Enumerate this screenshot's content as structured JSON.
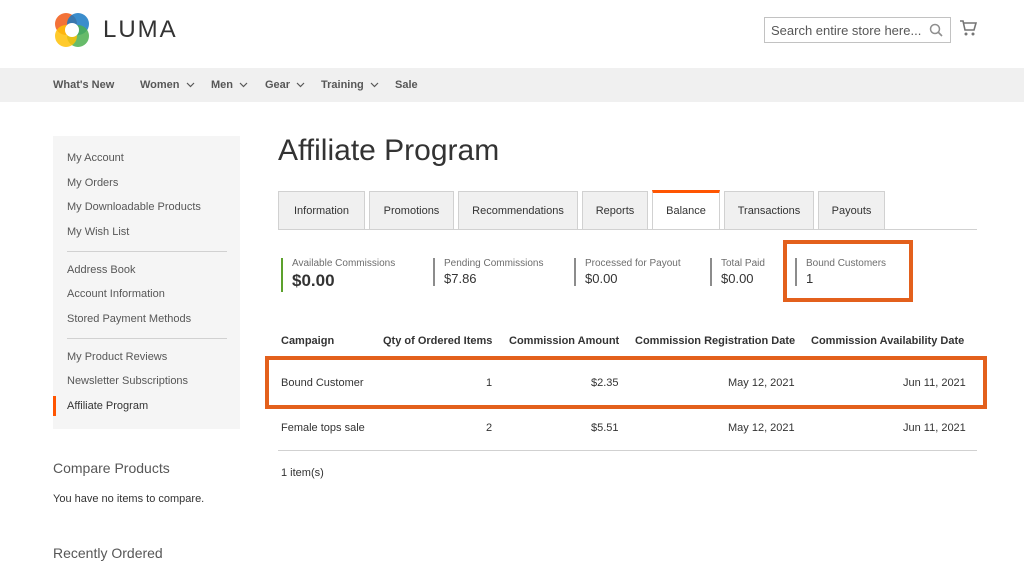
{
  "header": {
    "brand": "LUMA",
    "search_placeholder": "Search entire store here..."
  },
  "nav": [
    {
      "label": "What's New",
      "has_dropdown": false
    },
    {
      "label": "Women",
      "has_dropdown": true
    },
    {
      "label": "Men",
      "has_dropdown": true
    },
    {
      "label": "Gear",
      "has_dropdown": true
    },
    {
      "label": "Training",
      "has_dropdown": true
    },
    {
      "label": "Sale",
      "has_dropdown": false
    }
  ],
  "sidebar": {
    "group1": [
      "My Account",
      "My Orders",
      "My Downloadable Products",
      "My Wish List"
    ],
    "group2": [
      "Address Book",
      "Account Information",
      "Stored Payment Methods"
    ],
    "group3": [
      "My Product Reviews",
      "Newsletter Subscriptions",
      "Affiliate Program"
    ],
    "active": "Affiliate Program"
  },
  "compare": {
    "title": "Compare Products",
    "empty_text": "You have no items to compare."
  },
  "recent": {
    "title": "Recently Ordered"
  },
  "main": {
    "title": "Affiliate Program",
    "tabs": [
      "Information",
      "Promotions",
      "Recommendations",
      "Reports",
      "Balance",
      "Transactions",
      "Payouts"
    ],
    "active_tab": "Balance",
    "stats": [
      {
        "label": "Available Commissions",
        "value": "$0.00"
      },
      {
        "label": "Pending Commissions",
        "value": "$7.86"
      },
      {
        "label": "Processed for Payout",
        "value": "$0.00"
      },
      {
        "label": "Total Paid",
        "value": "$0.00"
      },
      {
        "label": "Bound Customers",
        "value": "1"
      }
    ],
    "table": {
      "headers": [
        "Campaign",
        "Qty of Ordered Items",
        "Commission Amount",
        "Commission Registration Date",
        "Commission Availability Date"
      ],
      "rows": [
        [
          "Bound Customer",
          "1",
          "$2.35",
          "May 12, 2021",
          "Jun 11, 2021"
        ],
        [
          "Female tops sale",
          "2",
          "$5.51",
          "May 12, 2021",
          "Jun 11, 2021"
        ]
      ]
    },
    "items_count": "1 item(s)"
  },
  "colors": {
    "accent": "#ff5501",
    "highlight": "#e3601c",
    "positive": "#5ca12d"
  }
}
